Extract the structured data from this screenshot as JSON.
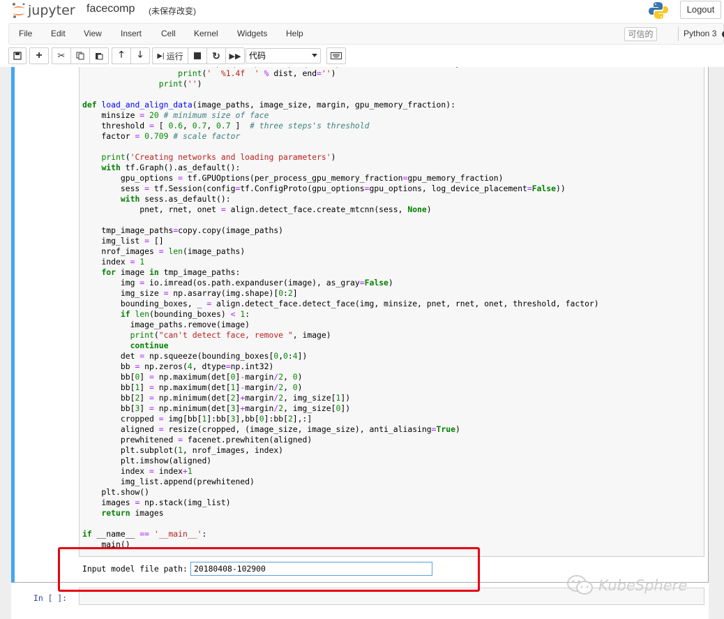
{
  "header": {
    "logo_text": "jupyter",
    "notebook_name": "facecomp",
    "save_status": "(未保存改变)",
    "logout_label": "Logout"
  },
  "menu": {
    "items": [
      "File",
      "Edit",
      "View",
      "Insert",
      "Cell",
      "Kernel",
      "Widgets",
      "Help"
    ],
    "trusted": "可信的",
    "kernel_name": "Python 3"
  },
  "toolbar": {
    "run_label": "运行",
    "cell_type": "代码"
  },
  "code_lines": [
    "                    dist = np.sqrt(np.sum(np.square(np.subtract(emb[i,:], emb[j,:]))))",
    "                    print('  %1.4f  ' % dist, end='')",
    "                print('')",
    "",
    "def load_and_align_data(image_paths, image_size, margin, gpu_memory_fraction):",
    "    minsize = 20 # minimum size of face",
    "    threshold = [ 0.6, 0.7, 0.7 ]  # three steps's threshold",
    "    factor = 0.709 # scale factor",
    "",
    "    print('Creating networks and loading parameters')",
    "    with tf.Graph().as_default():",
    "        gpu_options = tf.GPUOptions(per_process_gpu_memory_fraction=gpu_memory_fraction)",
    "        sess = tf.Session(config=tf.ConfigProto(gpu_options=gpu_options, log_device_placement=False))",
    "        with sess.as_default():",
    "            pnet, rnet, onet = align.detect_face.create_mtcnn(sess, None)",
    "",
    "    tmp_image_paths=copy.copy(image_paths)",
    "    img_list = []",
    "    nrof_images = len(image_paths)",
    "    index = 1",
    "    for image in tmp_image_paths:",
    "        img = io.imread(os.path.expanduser(image), as_gray=False)",
    "        img_size = np.asarray(img.shape)[0:2]",
    "        bounding_boxes, _ = align.detect_face.detect_face(img, minsize, pnet, rnet, onet, threshold, factor)",
    "        if len(bounding_boxes) < 1:",
    "          image_paths.remove(image)",
    "          print(\"can't detect face, remove \", image)",
    "          continue",
    "        det = np.squeeze(bounding_boxes[0,0:4])",
    "        bb = np.zeros(4, dtype=np.int32)",
    "        bb[0] = np.maximum(det[0]-margin/2, 0)",
    "        bb[1] = np.maximum(det[1]-margin/2, 0)",
    "        bb[2] = np.minimum(det[2]+margin/2, img_size[1])",
    "        bb[3] = np.minimum(det[3]+margin/2, img_size[0])",
    "        cropped = img[bb[1]:bb[3],bb[0]:bb[2],:]",
    "        aligned = resize(cropped, (image_size, image_size), anti_aliasing=True)",
    "        prewhitened = facenet.prewhiten(aligned)",
    "        plt.subplot(1, nrof_images, index)",
    "        plt.imshow(aligned)",
    "        index = index+1",
    "        img_list.append(prewhitened)",
    "    plt.show()",
    "    images = np.stack(img_list)",
    "    return images",
    "",
    "if __name__ == '__main__':",
    "    main()"
  ],
  "output": {
    "prompt_label": "Input model file path:",
    "input_value": "20180408-102900"
  },
  "next_cell": {
    "prompt": "In  [ ]:"
  },
  "watermark": "KubeSphere"
}
